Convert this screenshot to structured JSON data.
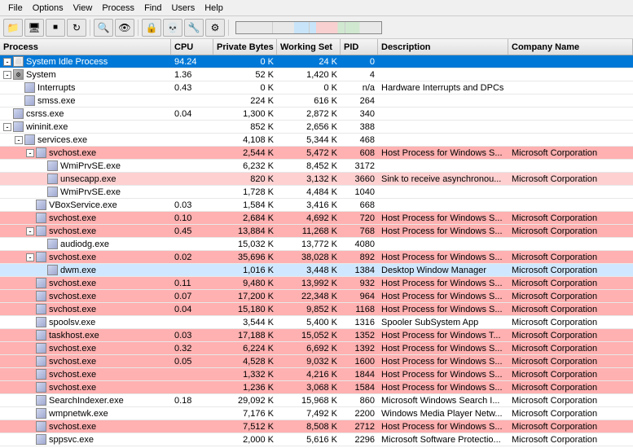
{
  "menubar": {
    "items": [
      "File",
      "Options",
      "View",
      "Process",
      "Find",
      "Users",
      "Help"
    ]
  },
  "toolbar": {
    "buttons": [
      "📁",
      "🖥️",
      "⏹",
      "🔄",
      "🔍",
      "👁",
      "🔒",
      "💀",
      "🔧",
      "⚙"
    ]
  },
  "columns": {
    "process": "Process",
    "cpu": "CPU",
    "private": "Private Bytes",
    "working": "Working Set",
    "pid": "PID",
    "description": "Description",
    "company": "Company Name"
  },
  "processes": [
    {
      "indent": 0,
      "expand": true,
      "name": "System Idle Process",
      "cpu": "94.24",
      "private": "0 K",
      "working": "24 K",
      "pid": "0",
      "desc": "",
      "company": "",
      "color": "blue",
      "selected": true
    },
    {
      "indent": 0,
      "expand": true,
      "name": "System",
      "cpu": "1.36",
      "private": "52 K",
      "working": "1,420 K",
      "pid": "4",
      "desc": "",
      "company": "",
      "color": "white"
    },
    {
      "indent": 1,
      "expand": false,
      "name": "Interrupts",
      "cpu": "0.43",
      "private": "0 K",
      "working": "0 K",
      "pid": "n/a",
      "desc": "Hardware Interrupts and DPCs",
      "company": "",
      "color": "white"
    },
    {
      "indent": 1,
      "expand": false,
      "name": "smss.exe",
      "cpu": "",
      "private": "224 K",
      "working": "616 K",
      "pid": "264",
      "desc": "",
      "company": "",
      "color": "white"
    },
    {
      "indent": 0,
      "expand": false,
      "name": "csrss.exe",
      "cpu": "0.04",
      "private": "1,300 K",
      "working": "2,872 K",
      "pid": "340",
      "desc": "",
      "company": "",
      "color": "white"
    },
    {
      "indent": 0,
      "expand": true,
      "name": "wininit.exe",
      "cpu": "",
      "private": "852 K",
      "working": "2,656 K",
      "pid": "388",
      "desc": "",
      "company": "",
      "color": "white"
    },
    {
      "indent": 1,
      "expand": true,
      "name": "services.exe",
      "cpu": "",
      "private": "4,108 K",
      "working": "5,344 K",
      "pid": "468",
      "desc": "",
      "company": "",
      "color": "white"
    },
    {
      "indent": 2,
      "expand": true,
      "name": "svchost.exe",
      "cpu": "",
      "private": "2,544 K",
      "working": "5,472 K",
      "pid": "608",
      "desc": "Host Process for Windows S...",
      "company": "Microsoft Corporation",
      "color": "pink"
    },
    {
      "indent": 3,
      "expand": false,
      "name": "WmiPrvSE.exe",
      "cpu": "",
      "private": "6,232 K",
      "working": "8,452 K",
      "pid": "3172",
      "desc": "",
      "company": "",
      "color": "white"
    },
    {
      "indent": 3,
      "expand": false,
      "name": "unsecapp.exe",
      "cpu": "",
      "private": "820 K",
      "working": "3,132 K",
      "pid": "3660",
      "desc": "Sink to receive asynchronou...",
      "company": "Microsoft Corporation",
      "color": "light-pink"
    },
    {
      "indent": 3,
      "expand": false,
      "name": "WmiPrvSE.exe",
      "cpu": "",
      "private": "1,728 K",
      "working": "4,484 K",
      "pid": "1040",
      "desc": "",
      "company": "",
      "color": "white"
    },
    {
      "indent": 2,
      "expand": false,
      "name": "VBoxService.exe",
      "cpu": "0.03",
      "private": "1,584 K",
      "working": "3,416 K",
      "pid": "668",
      "desc": "",
      "company": "",
      "color": "white"
    },
    {
      "indent": 2,
      "expand": false,
      "name": "svchost.exe",
      "cpu": "0.10",
      "private": "2,684 K",
      "working": "4,692 K",
      "pid": "720",
      "desc": "Host Process for Windows S...",
      "company": "Microsoft Corporation",
      "color": "pink"
    },
    {
      "indent": 2,
      "expand": true,
      "name": "svchost.exe",
      "cpu": "0.45",
      "private": "13,884 K",
      "working": "11,268 K",
      "pid": "768",
      "desc": "Host Process for Windows S...",
      "company": "Microsoft Corporation",
      "color": "pink"
    },
    {
      "indent": 3,
      "expand": false,
      "name": "audiodg.exe",
      "cpu": "",
      "private": "15,032 K",
      "working": "13,772 K",
      "pid": "4080",
      "desc": "",
      "company": "",
      "color": "white"
    },
    {
      "indent": 2,
      "expand": true,
      "name": "svchost.exe",
      "cpu": "0.02",
      "private": "35,696 K",
      "working": "38,028 K",
      "pid": "892",
      "desc": "Host Process for Windows S...",
      "company": "Microsoft Corporation",
      "color": "pink"
    },
    {
      "indent": 3,
      "expand": false,
      "name": "dwm.exe",
      "cpu": "",
      "private": "1,016 K",
      "working": "3,448 K",
      "pid": "1384",
      "desc": "Desktop Window Manager",
      "company": "Microsoft Corporation",
      "color": "light-blue"
    },
    {
      "indent": 2,
      "expand": false,
      "name": "svchost.exe",
      "cpu": "0.11",
      "private": "9,480 K",
      "working": "13,992 K",
      "pid": "932",
      "desc": "Host Process for Windows S...",
      "company": "Microsoft Corporation",
      "color": "pink"
    },
    {
      "indent": 2,
      "expand": false,
      "name": "svchost.exe",
      "cpu": "0.07",
      "private": "17,200 K",
      "working": "22,348 K",
      "pid": "964",
      "desc": "Host Process for Windows S...",
      "company": "Microsoft Corporation",
      "color": "pink"
    },
    {
      "indent": 2,
      "expand": false,
      "name": "svchost.exe",
      "cpu": "0.04",
      "private": "15,180 K",
      "working": "9,852 K",
      "pid": "1168",
      "desc": "Host Process for Windows S...",
      "company": "Microsoft Corporation",
      "color": "pink"
    },
    {
      "indent": 2,
      "expand": false,
      "name": "spoolsv.exe",
      "cpu": "",
      "private": "3,544 K",
      "working": "5,400 K",
      "pid": "1316",
      "desc": "Spooler SubSystem App",
      "company": "Microsoft Corporation",
      "color": "white"
    },
    {
      "indent": 2,
      "expand": false,
      "name": "taskhost.exe",
      "cpu": "0.03",
      "private": "17,188 K",
      "working": "15,052 K",
      "pid": "1352",
      "desc": "Host Process for Windows T...",
      "company": "Microsoft Corporation",
      "color": "pink"
    },
    {
      "indent": 2,
      "expand": false,
      "name": "svchost.exe",
      "cpu": "0.32",
      "private": "6,224 K",
      "working": "6,692 K",
      "pid": "1392",
      "desc": "Host Process for Windows S...",
      "company": "Microsoft Corporation",
      "color": "pink"
    },
    {
      "indent": 2,
      "expand": false,
      "name": "svchost.exe",
      "cpu": "0.05",
      "private": "4,528 K",
      "working": "9,032 K",
      "pid": "1600",
      "desc": "Host Process for Windows S...",
      "company": "Microsoft Corporation",
      "color": "pink"
    },
    {
      "indent": 2,
      "expand": false,
      "name": "svchost.exe",
      "cpu": "",
      "private": "1,332 K",
      "working": "4,216 K",
      "pid": "1844",
      "desc": "Host Process for Windows S...",
      "company": "Microsoft Corporation",
      "color": "pink"
    },
    {
      "indent": 2,
      "expand": false,
      "name": "svchost.exe",
      "cpu": "",
      "private": "1,236 K",
      "working": "3,068 K",
      "pid": "1584",
      "desc": "Host Process for Windows S...",
      "company": "Microsoft Corporation",
      "color": "pink"
    },
    {
      "indent": 2,
      "expand": false,
      "name": "SearchIndexer.exe",
      "cpu": "0.18",
      "private": "29,092 K",
      "working": "15,968 K",
      "pid": "860",
      "desc": "Microsoft Windows Search I...",
      "company": "Microsoft Corporation",
      "color": "white"
    },
    {
      "indent": 2,
      "expand": false,
      "name": "wmpnetwk.exe",
      "cpu": "",
      "private": "7,176 K",
      "working": "7,492 K",
      "pid": "2200",
      "desc": "Windows Media Player Netw...",
      "company": "Microsoft Corporation",
      "color": "white"
    },
    {
      "indent": 2,
      "expand": false,
      "name": "svchost.exe",
      "cpu": "",
      "private": "7,512 K",
      "working": "8,508 K",
      "pid": "2712",
      "desc": "Host Process for Windows S...",
      "company": "Microsoft Corporation",
      "color": "pink"
    },
    {
      "indent": 2,
      "expand": false,
      "name": "sppsvc.exe",
      "cpu": "",
      "private": "2,000 K",
      "working": "5,616 K",
      "pid": "2296",
      "desc": "Microsoft Software Protectio...",
      "company": "Microsoft Corporation",
      "color": "white"
    }
  ]
}
